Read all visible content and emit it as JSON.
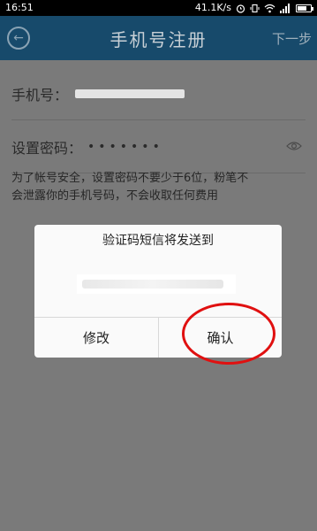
{
  "status_bar": {
    "time": "16:51",
    "speed": "41.1K/s"
  },
  "app_bar": {
    "title": "手机号注册",
    "next": "下一步"
  },
  "form": {
    "phone_label": "手机号：",
    "password_label": "设置密码：",
    "password_mask": "•••••••",
    "hint_line1": "为了帐号安全，设置密码不要少于6位，粉笔不",
    "hint_line2": "会泄露你的手机号码，不会收取任何费用"
  },
  "dialog": {
    "title": "验证码短信将发送到",
    "cancel_label": "修改",
    "confirm_label": "确认"
  },
  "colors": {
    "app_bar": "#174a6b",
    "overlay": "#7a7a7a",
    "highlight_circle": "#e01010"
  }
}
